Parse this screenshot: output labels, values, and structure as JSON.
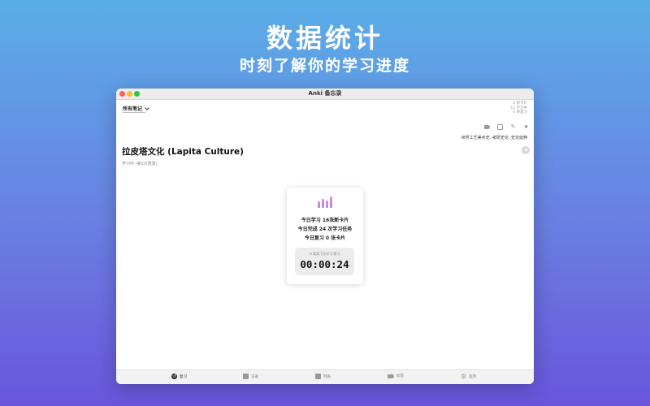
{
  "hero": {
    "title": "数据统计",
    "subtitle": "时刻了解你的学习进度"
  },
  "window": {
    "title": "Anki 备忘录"
  },
  "deck": {
    "selected": "所有笔记",
    "chevron_icon": "chevron-down-icon"
  },
  "counts": {
    "new_label": "0 新卡片",
    "learning_label": "12 学习中",
    "review_label": "0 待复习"
  },
  "toolbar": {
    "icons": [
      "tag-icon",
      "square-icon",
      "pencil-icon",
      "star-icon"
    ],
    "pencil_glyph": "✎",
    "star_glyph": "★"
  },
  "card": {
    "tags": "世界工艺美术史, 考研史论, 史论延伸",
    "title": "拉皮塔文化 (Lapita Culture)",
    "status": "学习中 (第2次重复)",
    "play_glyph": "◀"
  },
  "stats": {
    "chart_icon": "bar-chart-icon",
    "line1": "今日学习 16张新卡片",
    "line2": "今日完成 24 次学习任务",
    "line3": "今日复习 0 张卡片",
    "timer_label": "◔ 距离下次学习/复习",
    "timer_value": "00:00:24",
    "accent_gradient": [
      "#e58ec0",
      "#a78fd8"
    ]
  },
  "tabs": [
    {
      "label": "复习",
      "icon": "review-icon",
      "glyph": "↺"
    },
    {
      "label": "记录",
      "icon": "record-icon",
      "glyph": ""
    },
    {
      "label": "列表",
      "icon": "list-icon",
      "glyph": ""
    },
    {
      "label": "标签",
      "icon": "tag-icon",
      "glyph": ""
    },
    {
      "label": "选项",
      "icon": "gear-icon",
      "glyph": "⚙"
    }
  ],
  "colors": {
    "bg_top": "#5aaee8",
    "bg_bottom": "#6a55dc"
  }
}
